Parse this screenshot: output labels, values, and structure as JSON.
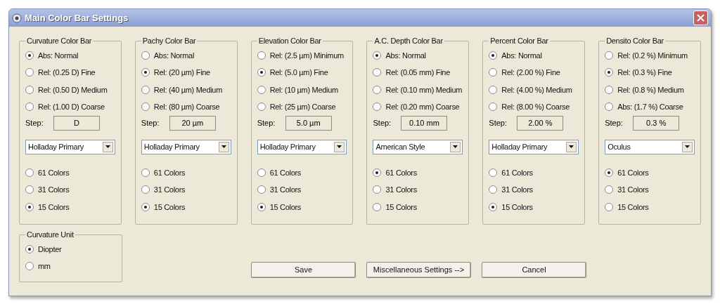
{
  "window": {
    "title": "Main Color Bar Settings"
  },
  "panels": [
    {
      "title": "Curvature Color Bar",
      "scales": [
        {
          "label": "Abs: Normal",
          "selected": true
        },
        {
          "label": "Rel: (0.25 D) Fine",
          "selected": false
        },
        {
          "label": "Rel: (0.50 D) Medium",
          "selected": false
        },
        {
          "label": "Rel: (1.00 D) Coarse",
          "selected": false
        }
      ],
      "step_label": "Step:",
      "step": "D",
      "palette": "Holladay Primary",
      "colors": [
        {
          "label": "61 Colors",
          "selected": false
        },
        {
          "label": "31 Colors",
          "selected": false
        },
        {
          "label": "15 Colors",
          "selected": true
        }
      ]
    },
    {
      "title": "Pachy Color Bar",
      "scales": [
        {
          "label": "Abs: Normal",
          "selected": false
        },
        {
          "label": "Rel: (20 µm) Fine",
          "selected": true
        },
        {
          "label": "Rel: (40 µm) Medium",
          "selected": false
        },
        {
          "label": "Rel: (80 µm) Coarse",
          "selected": false
        }
      ],
      "step_label": "Step:",
      "step": "20 µm",
      "palette": "Holladay Primary",
      "colors": [
        {
          "label": "61 Colors",
          "selected": false
        },
        {
          "label": "31 Colors",
          "selected": false
        },
        {
          "label": "15 Colors",
          "selected": true
        }
      ]
    },
    {
      "title": "Elevation Color Bar",
      "scales": [
        {
          "label": "Rel: (2.5 µm) Minimum",
          "selected": false
        },
        {
          "label": "Rel: (5.0 µm) Fine",
          "selected": true
        },
        {
          "label": "Rel: (10 µm) Medium",
          "selected": false
        },
        {
          "label": "Rel: (25 µm) Coarse",
          "selected": false
        }
      ],
      "step_label": "Step:",
      "step": "5.0 µm",
      "palette": "Holladay Primary",
      "colors": [
        {
          "label": "61 Colors",
          "selected": false
        },
        {
          "label": "31 Colors",
          "selected": false
        },
        {
          "label": "15 Colors",
          "selected": true
        }
      ]
    },
    {
      "title": "A.C. Depth Color Bar",
      "scales": [
        {
          "label": "Abs: Normal",
          "selected": true
        },
        {
          "label": "Rel: (0.05 mm) Fine",
          "selected": false
        },
        {
          "label": "Rel: (0.10 mm) Medium",
          "selected": false
        },
        {
          "label": "Rel: (0.20 mm) Coarse",
          "selected": false
        }
      ],
      "step_label": "Step:",
      "step": "0.10 mm",
      "palette": "American Style",
      "colors": [
        {
          "label": "61 Colors",
          "selected": true
        },
        {
          "label": "31 Colors",
          "selected": false
        },
        {
          "label": "15 Colors",
          "selected": false
        }
      ]
    },
    {
      "title": "Percent Color Bar",
      "scales": [
        {
          "label": "Abs: Normal",
          "selected": true
        },
        {
          "label": "Rel: (2.00 %) Fine",
          "selected": false
        },
        {
          "label": "Rel: (4.00 %) Medium",
          "selected": false
        },
        {
          "label": "Rel: (8.00 %) Coarse",
          "selected": false
        }
      ],
      "step_label": "Step:",
      "step": "2.00 %",
      "palette": "Holladay Primary",
      "colors": [
        {
          "label": "61 Colors",
          "selected": false
        },
        {
          "label": "31 Colors",
          "selected": false
        },
        {
          "label": "15 Colors",
          "selected": true
        }
      ]
    },
    {
      "title": "Densito Color Bar",
      "scales": [
        {
          "label": "Rel: (0.2 %) Minimum",
          "selected": false
        },
        {
          "label": "Rel: (0.3 %) Fine",
          "selected": true
        },
        {
          "label": "Rel: (0.8 %) Medium",
          "selected": false
        },
        {
          "label": "Abs: (1.7 %) Coarse",
          "selected": false
        }
      ],
      "step_label": "Step:",
      "step": "0.3 %",
      "palette": "Oculus",
      "colors": [
        {
          "label": "61 Colors",
          "selected": true
        },
        {
          "label": "31 Colors",
          "selected": false
        },
        {
          "label": "15 Colors",
          "selected": false
        }
      ]
    }
  ],
  "curvature_unit": {
    "title": "Curvature Unit",
    "options": [
      {
        "label": "Diopter",
        "selected": true
      },
      {
        "label": "mm",
        "selected": false
      }
    ]
  },
  "buttons": [
    "Save",
    "Miscellaneous Settings -->",
    "Cancel"
  ]
}
